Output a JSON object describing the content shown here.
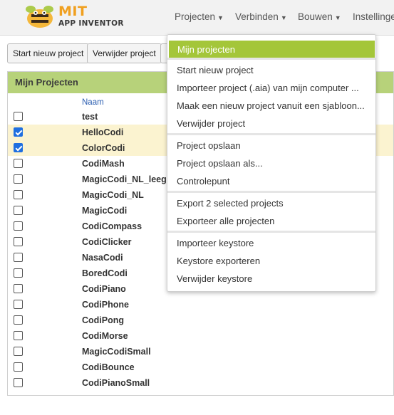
{
  "header": {
    "logo_mit": "MIT",
    "logo_app": "APP INVENTOR",
    "nav": [
      "Projecten",
      "Verbinden",
      "Bouwen",
      "Instellingen"
    ]
  },
  "toolbar": {
    "start_new": "Start nieuw project",
    "delete": "Verwijder project"
  },
  "panel": {
    "title": "Mijn Projecten",
    "column_name": "Naam",
    "projects": [
      {
        "name": "test",
        "checked": false
      },
      {
        "name": "HelloCodi",
        "checked": true
      },
      {
        "name": "ColorCodi",
        "checked": true
      },
      {
        "name": "CodiMash",
        "checked": false
      },
      {
        "name": "MagicCodi_NL_leeg",
        "checked": false
      },
      {
        "name": "MagicCodi_NL",
        "checked": false
      },
      {
        "name": "MagicCodi",
        "checked": false
      },
      {
        "name": "CodiCompass",
        "checked": false
      },
      {
        "name": "CodiClicker",
        "checked": false
      },
      {
        "name": "NasaCodi",
        "checked": false
      },
      {
        "name": "BoredCodi",
        "checked": false
      },
      {
        "name": "CodiPiano",
        "checked": false
      },
      {
        "name": "CodiPhone",
        "checked": false
      },
      {
        "name": "CodiPong",
        "checked": false
      },
      {
        "name": "CodiMorse",
        "checked": false
      },
      {
        "name": "MagicCodiSmall",
        "checked": false
      },
      {
        "name": "CodiBounce",
        "checked": false
      },
      {
        "name": "CodiPianoSmall",
        "checked": false
      }
    ]
  },
  "menu": {
    "items": [
      "Mijn projecten",
      "Start nieuw project",
      "Importeer project (.aia) van mijn computer ...",
      "Maak een nieuw project vanuit een sjabloon...",
      "Verwijder project",
      "Project opslaan",
      "Project opslaan als...",
      "Controlepunt",
      "Export 2 selected projects",
      "Exporteer alle projecten",
      "Importeer keystore",
      "Keystore exporteren",
      "Verwijder keystore"
    ]
  },
  "colors": {
    "accent_green": "#a4c639",
    "panel_header": "#b7d27a",
    "logo_orange": "#f0a020",
    "selected_row": "#fbf3d0",
    "checkbox_blue": "#1f6fe0"
  }
}
